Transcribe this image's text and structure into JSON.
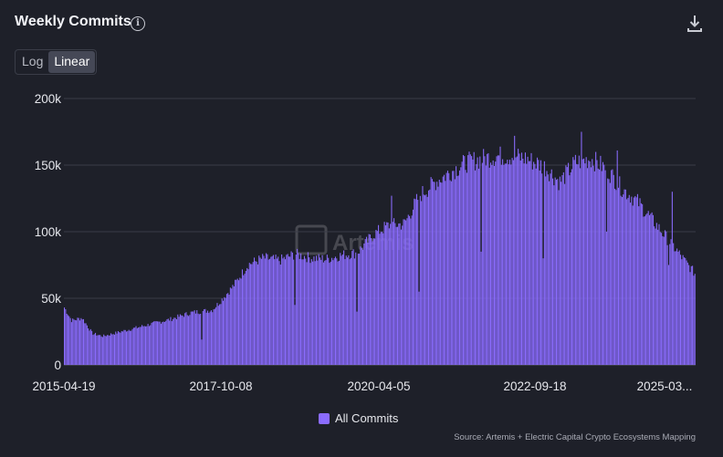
{
  "header": {
    "title": "Weekly Commits",
    "info_icon": "info-icon",
    "download_icon": "download-icon"
  },
  "scale_toggle": {
    "options": [
      "Log",
      "Linear"
    ],
    "selected": "Linear"
  },
  "watermark": "Artemis",
  "legend": {
    "label": "All Commits",
    "color": "#8b6cff"
  },
  "source": "Source: Artemis + Electric Capital Crypto Ecosystems Mapping",
  "colors": {
    "background": "#1e2029",
    "grid": "#3a3d48",
    "bar": "#8b6cff"
  },
  "chart_data": {
    "type": "bar",
    "ylim": [
      0,
      200000
    ],
    "yticks": [
      0,
      50000,
      100000,
      150000,
      200000
    ],
    "ytick_labels": [
      "0",
      "50k",
      "100k",
      "150k",
      "200k"
    ],
    "xtick_labels": [
      "2015-04-19",
      "2017-10-08",
      "2020-04-05",
      "2022-09-18",
      "2025-03..."
    ],
    "grid": true,
    "legend_position": "bottom",
    "series": [
      {
        "name": "All Commits",
        "color": "#8b6cff",
        "start_date": "2015-04-19",
        "interval": "weekly",
        "keyframes": [
          [
            "2015-04-19",
            44000
          ],
          [
            "2015-06-01",
            34000
          ],
          [
            "2015-08-01",
            36000
          ],
          [
            "2015-10-01",
            24000
          ],
          [
            "2015-12-01",
            22000
          ],
          [
            "2016-02-01",
            24000
          ],
          [
            "2016-06-01",
            28000
          ],
          [
            "2016-10-01",
            32000
          ],
          [
            "2017-01-01",
            35000
          ],
          [
            "2017-05-01",
            40000
          ],
          [
            "2017-09-01",
            42000
          ],
          [
            "2017-10-08",
            47000
          ],
          [
            "2018-01-01",
            60000
          ],
          [
            "2018-04-01",
            77000
          ],
          [
            "2018-07-01",
            82000
          ],
          [
            "2018-10-01",
            80000
          ],
          [
            "2019-01-01",
            85000
          ],
          [
            "2019-04-01",
            82000
          ],
          [
            "2019-07-01",
            81000
          ],
          [
            "2019-10-01",
            84000
          ],
          [
            "2020-01-01",
            86000
          ],
          [
            "2020-04-05",
            100000
          ],
          [
            "2020-07-01",
            107000
          ],
          [
            "2020-10-01",
            108000
          ],
          [
            "2021-01-01",
            130000
          ],
          [
            "2021-04-01",
            140000
          ],
          [
            "2021-07-01",
            148000
          ],
          [
            "2021-10-01",
            155000
          ],
          [
            "2022-01-01",
            158000
          ],
          [
            "2022-04-01",
            160000
          ],
          [
            "2022-07-01",
            160000
          ],
          [
            "2022-09-18",
            158000
          ],
          [
            "2023-01-01",
            152000
          ],
          [
            "2023-04-01",
            140000
          ],
          [
            "2023-07-01",
            155000
          ],
          [
            "2023-10-01",
            158000
          ],
          [
            "2024-01-01",
            150000
          ],
          [
            "2024-04-01",
            135000
          ],
          [
            "2024-07-01",
            125000
          ],
          [
            "2024-10-01",
            110000
          ],
          [
            "2025-01-01",
            95000
          ],
          [
            "2025-04-01",
            80000
          ],
          [
            "2025-06-01",
            70000
          ]
        ],
        "dips": [
          [
            "2017-07-02",
            19000
          ],
          [
            "2018-12-30",
            45000
          ],
          [
            "2019-12-29",
            40000
          ],
          [
            "2020-12-27",
            55000
          ],
          [
            "2021-12-26",
            85000
          ],
          [
            "2022-12-25",
            80000
          ],
          [
            "2023-12-31",
            100000
          ],
          [
            "2024-12-29",
            75000
          ]
        ],
        "spikes": [
          [
            "2023-08-06",
            175000
          ],
          [
            "2022-07-10",
            172000
          ],
          [
            "2024-03-03",
            161000
          ],
          [
            "2025-01-19",
            130000
          ],
          [
            "2020-07-19",
            127000
          ]
        ]
      }
    ]
  }
}
